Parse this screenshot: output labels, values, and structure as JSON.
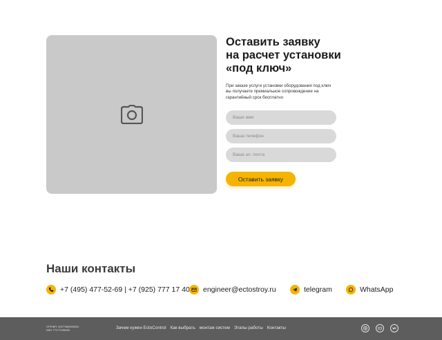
{
  "form": {
    "title_line1": "Оставить заявку",
    "title_line2": "на расчет установки",
    "title_line3": "«под ключ»",
    "description": "При заказе услуги установки оборудования под ключ вы получаете премиальное сопровождение на гарантийный срок бесплатно",
    "name_placeholder": "Ваше имя",
    "phone_placeholder": "Ваша телефон",
    "email_placeholder": "Ваша эл. почта",
    "submit_label": "Оставить заявку"
  },
  "hero": {
    "icon": "camera-icon"
  },
  "contacts": {
    "title": "Наши контакты",
    "phone": "+7 (495) 477-52-69 | +7 (925) 777 17 40",
    "email": "engineer@ectostroy.ru",
    "telegram": "telegram",
    "whatsapp": "WhatsApp"
  },
  "footer": {
    "ogrnip": "ОГРНИП: 319774600430044",
    "inn": "ИНН: 771771356405",
    "nav": [
      "Зачем нужен EctoControl",
      "Как выбрать",
      "монтаж систем",
      "Этапы работы",
      "Контакты"
    ]
  },
  "colors": {
    "accent": "#f5b400",
    "footer_bg": "#5d5d5d",
    "placeholder_bg": "#c9c9c9"
  }
}
